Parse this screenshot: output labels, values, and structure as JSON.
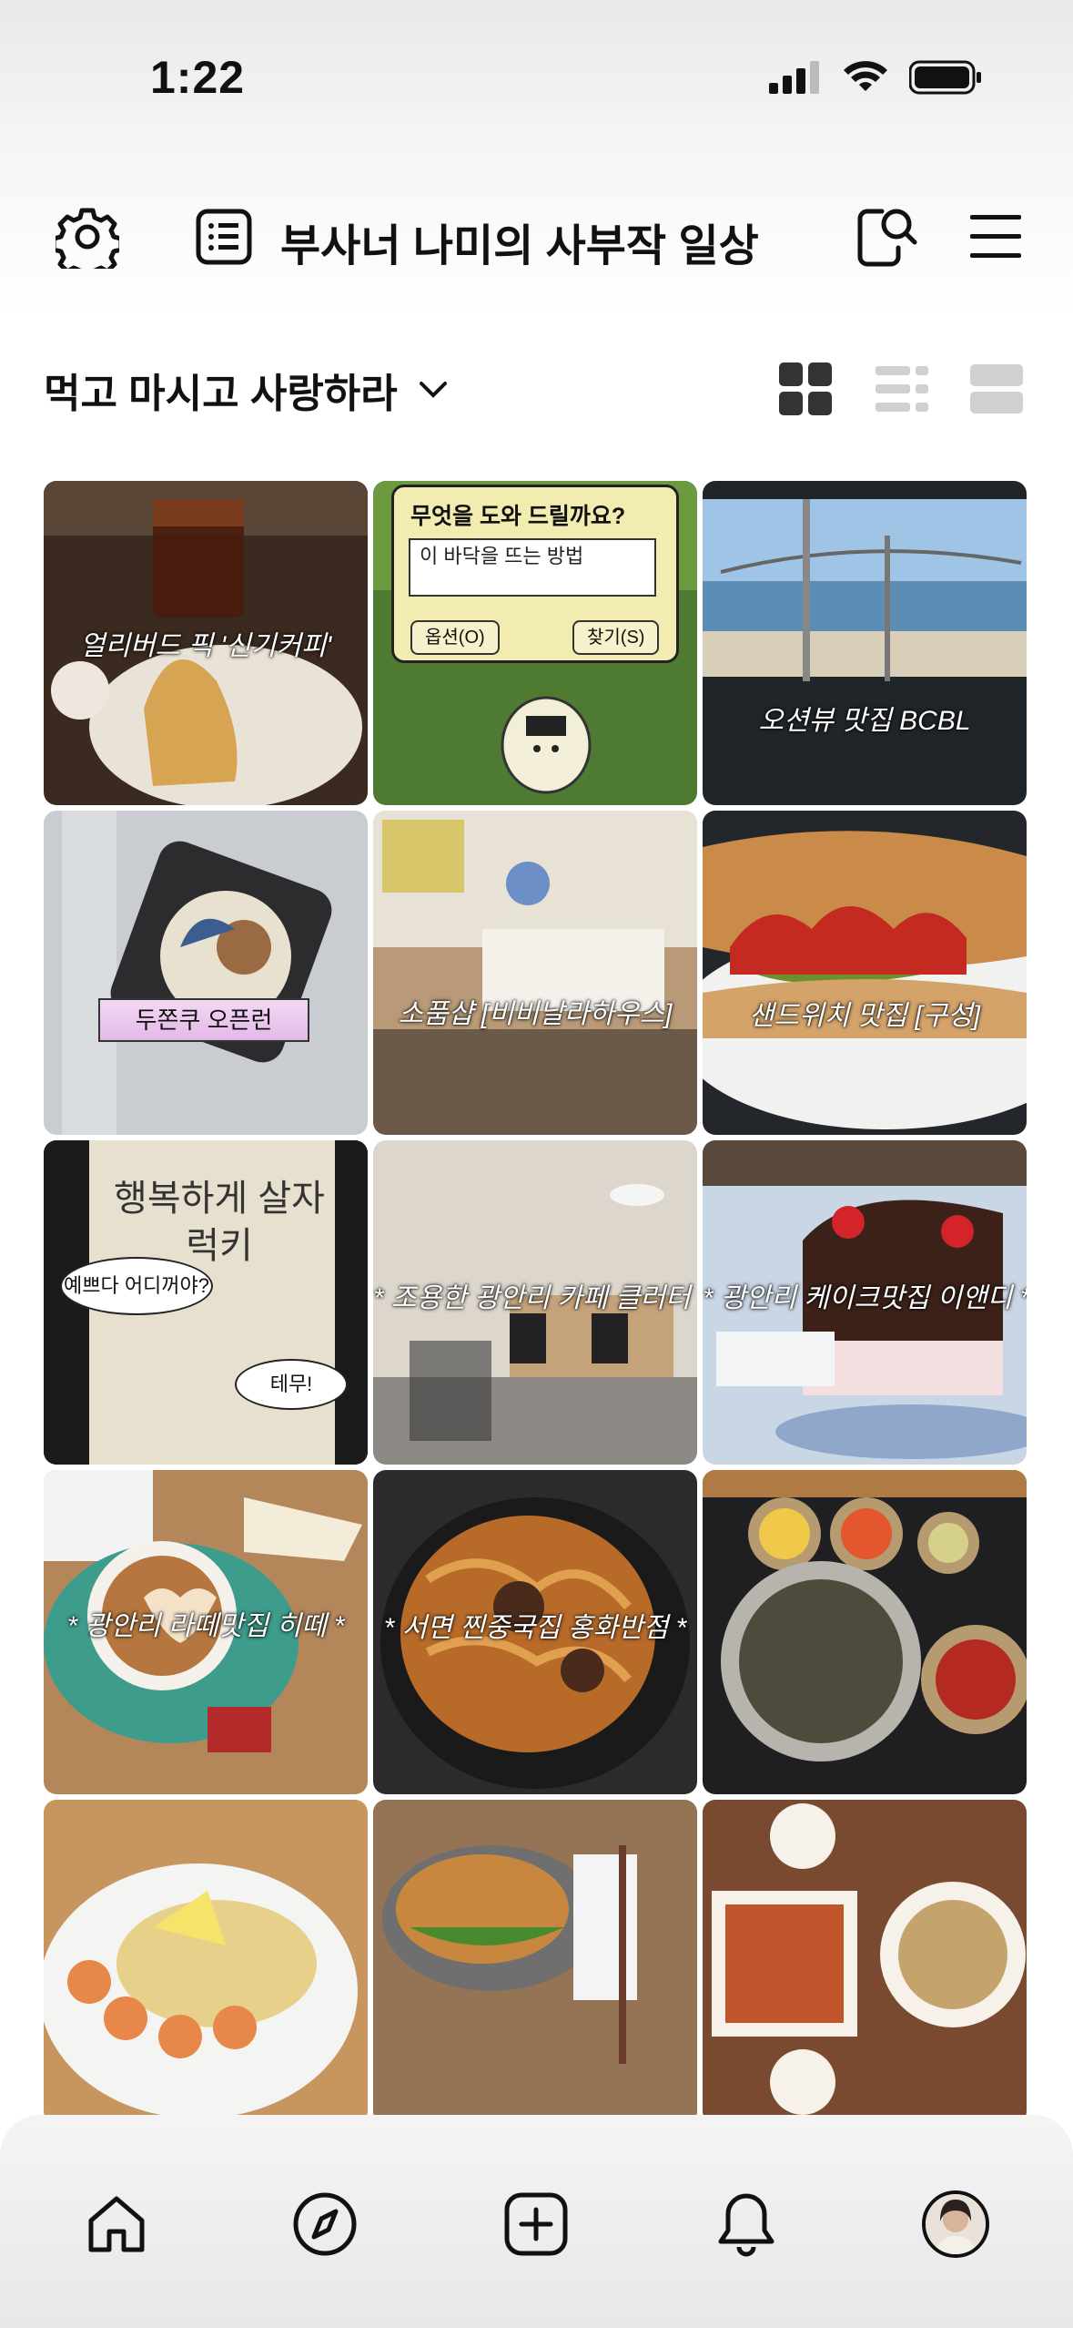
{
  "status": {
    "time": "1:22"
  },
  "header": {
    "blog_title": "부사너 나미의 사부작 일상",
    "icons": [
      "gear-icon",
      "list-icon",
      "search-icon",
      "menu-icon"
    ]
  },
  "category": {
    "title": "먹고 마시고 사랑하라",
    "chevron": "chevron-down-icon"
  },
  "view_modes": [
    "grid-view",
    "list-view",
    "album-view"
  ],
  "selected_view": "grid-view",
  "posts": [
    {
      "caption": "얼리버드 픽 '신기커피'"
    },
    {
      "dialog_title": "무엇을 도와 드릴까요?",
      "dialog_input": "이 바닥을 뜨는 방법",
      "dialog_options": "옵션(O)",
      "dialog_find": "찾기(S)"
    },
    {
      "caption": "오션뷰 맛집 BCBL"
    },
    {
      "caption": "두쫀쿠 오픈런"
    },
    {
      "caption": "소품샵 [비비날라하우스]"
    },
    {
      "caption": "샌드위치 맛집 [구성]"
    },
    {
      "photo_text": "행복하게 살자 럭키",
      "bubble_1": "예쁘다 어디꺼야?",
      "bubble_2": "테무!"
    },
    {
      "caption": "* 조용한 광안리 카페 클러터 *"
    },
    {
      "caption": "* 광안리 케이크맛집 이앤디 *"
    },
    {
      "caption": "* 광안리 라떼맛집 히떼 *"
    },
    {
      "caption": "* 서면 찐중국집 홍화반점 *"
    },
    {
      "caption": ""
    },
    {
      "caption": ""
    },
    {
      "caption": ""
    },
    {
      "caption": ""
    }
  ],
  "tabbar": {
    "tabs": [
      "home-icon",
      "compass-icon",
      "plus-icon",
      "bell-icon",
      "profile-avatar"
    ]
  }
}
